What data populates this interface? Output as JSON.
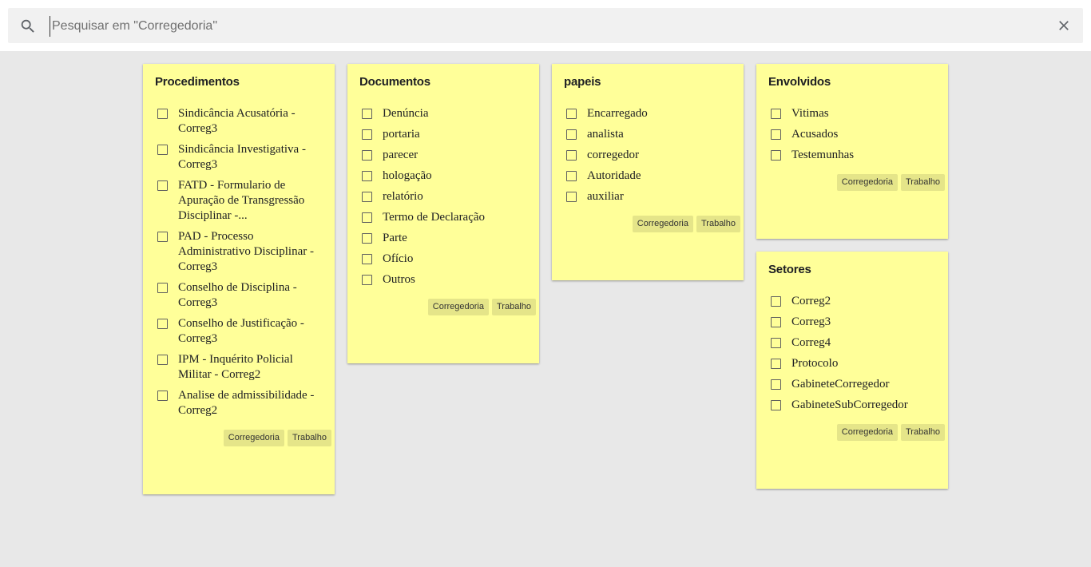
{
  "search": {
    "placeholder": "Pesquisar em \"Corregedoria\""
  },
  "notes": [
    {
      "title": "Procedimentos",
      "items": [
        "Sindicância Acusatória - Correg3",
        "Sindicância Investigativa - Correg3",
        "FATD - Formulario de Apuração de Transgressão Disciplinar -...",
        "PAD - Processo Administrativo Disciplinar - Correg3",
        "Conselho de Disciplina - Correg3",
        "Conselho de Justificação - Correg3",
        "IPM - Inquérito Policial Militar - Correg2",
        "Analise de admissibilidade - Correg2"
      ],
      "labels": [
        "Corregedoria",
        "Trabalho"
      ]
    },
    {
      "title": "Documentos",
      "items": [
        "Denúncia",
        "portaria",
        "parecer",
        "hologação",
        "relatório",
        "Termo de Declaração",
        "Parte",
        "Ofício",
        "Outros"
      ],
      "labels": [
        "Corregedoria",
        "Trabalho"
      ]
    },
    {
      "title": "papeis",
      "items": [
        "Encarregado",
        "analista",
        "corregedor",
        "Autoridade",
        "auxiliar"
      ],
      "labels": [
        "Corregedoria",
        "Trabalho"
      ]
    },
    {
      "title": "Envolvidos",
      "items": [
        "Vitimas",
        "Acusados",
        "Testemunhas"
      ],
      "labels": [
        "Corregedoria",
        "Trabalho"
      ]
    },
    {
      "title": "Setores",
      "items": [
        "Correg2",
        "Correg3",
        "Correg4",
        "Protocolo",
        "GabineteCorregedor",
        "GabineteSubCorregedor"
      ],
      "labels": [
        "Corregedoria",
        "Trabalho"
      ]
    }
  ]
}
